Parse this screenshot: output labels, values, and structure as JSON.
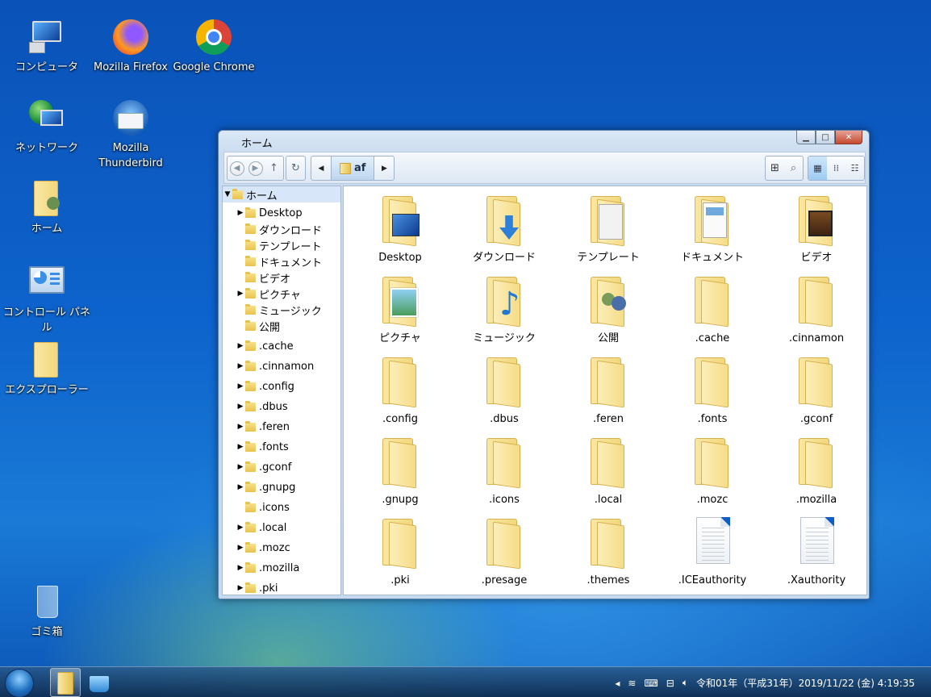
{
  "desktop": {
    "icons": [
      {
        "label": "コンピュータ",
        "icon": "computer-icon"
      },
      {
        "label": "Mozilla Firefox",
        "icon": "firefox-icon"
      },
      {
        "label": "Google Chrome",
        "icon": "chrome-icon"
      },
      {
        "label": "ネットワーク",
        "icon": "network-icon"
      },
      {
        "label_line1": "Mozilla",
        "label_line2": "Thunderbird",
        "icon": "thunderbird-icon"
      },
      {
        "label": "ホーム",
        "icon": "home-folder-icon"
      },
      {
        "label": "コントロール パネル",
        "icon": "control-panel-icon"
      },
      {
        "label": "エクスプローラー",
        "icon": "explorer-folder-icon"
      },
      {
        "label": "ゴミ箱",
        "icon": "trash-icon"
      }
    ]
  },
  "window": {
    "title": "ホーム",
    "buttons": {
      "minimize": "minimize-icon",
      "maximize": "maximize-icon",
      "close": "close-icon"
    },
    "toolbar": {
      "back": "back-icon",
      "forward": "forward-icon",
      "up": "up-arrow-icon",
      "reload": "reload-icon",
      "path_segment": "af",
      "new_folder": "new-folder-icon",
      "search": "search-icon"
    },
    "sidebar": {
      "root": "ホーム",
      "items": [
        {
          "label": "Desktop",
          "expandable": true
        },
        {
          "label": "ダウンロード",
          "expandable": false
        },
        {
          "label": "テンプレート",
          "expandable": false
        },
        {
          "label": "ドキュメント",
          "expandable": false
        },
        {
          "label": "ビデオ",
          "expandable": false
        },
        {
          "label": "ピクチャ",
          "expandable": true
        },
        {
          "label": "ミュージック",
          "expandable": false
        },
        {
          "label": "公開",
          "expandable": false
        },
        {
          "label": ".cache",
          "expandable": true
        },
        {
          "label": ".cinnamon",
          "expandable": true
        },
        {
          "label": ".config",
          "expandable": true
        },
        {
          "label": ".dbus",
          "expandable": true
        },
        {
          "label": ".feren",
          "expandable": true
        },
        {
          "label": ".fonts",
          "expandable": true
        },
        {
          "label": ".gconf",
          "expandable": true
        },
        {
          "label": ".gnupg",
          "expandable": true
        },
        {
          "label": ".icons",
          "expandable": false
        },
        {
          "label": ".local",
          "expandable": true
        },
        {
          "label": ".mozc",
          "expandable": true
        },
        {
          "label": ".mozilla",
          "expandable": true
        },
        {
          "label": ".pki",
          "expandable": true
        }
      ]
    },
    "files": [
      {
        "name": "Desktop",
        "type": "folder-desktop"
      },
      {
        "name": "ダウンロード",
        "type": "folder-download"
      },
      {
        "name": "テンプレート",
        "type": "folder-templates"
      },
      {
        "name": "ドキュメント",
        "type": "folder-documents"
      },
      {
        "name": "ビデオ",
        "type": "folder-video"
      },
      {
        "name": "ピクチャ",
        "type": "folder-pictures"
      },
      {
        "name": "ミュージック",
        "type": "folder-music"
      },
      {
        "name": "公開",
        "type": "folder-public"
      },
      {
        "name": ".cache",
        "type": "folder"
      },
      {
        "name": ".cinnamon",
        "type": "folder"
      },
      {
        "name": ".config",
        "type": "folder"
      },
      {
        "name": ".dbus",
        "type": "folder"
      },
      {
        "name": ".feren",
        "type": "folder"
      },
      {
        "name": ".fonts",
        "type": "folder"
      },
      {
        "name": ".gconf",
        "type": "folder"
      },
      {
        "name": ".gnupg",
        "type": "folder"
      },
      {
        "name": ".icons",
        "type": "folder"
      },
      {
        "name": ".local",
        "type": "folder"
      },
      {
        "name": ".mozc",
        "type": "folder"
      },
      {
        "name": ".mozilla",
        "type": "folder"
      },
      {
        "name": ".pki",
        "type": "folder"
      },
      {
        "name": ".presage",
        "type": "folder"
      },
      {
        "name": ".themes",
        "type": "folder"
      },
      {
        "name": ".ICEauthority",
        "type": "file"
      },
      {
        "name": ".Xauthority",
        "type": "file"
      }
    ]
  },
  "taskbar": {
    "start": "start-orb-icon",
    "clock": "令和01年（平成31年）2019/11/22 (金)  4:19:35"
  },
  "colors": {
    "accent": "#0d63cc",
    "folder": "#f3d77d",
    "selection": "#d7e7f9"
  }
}
